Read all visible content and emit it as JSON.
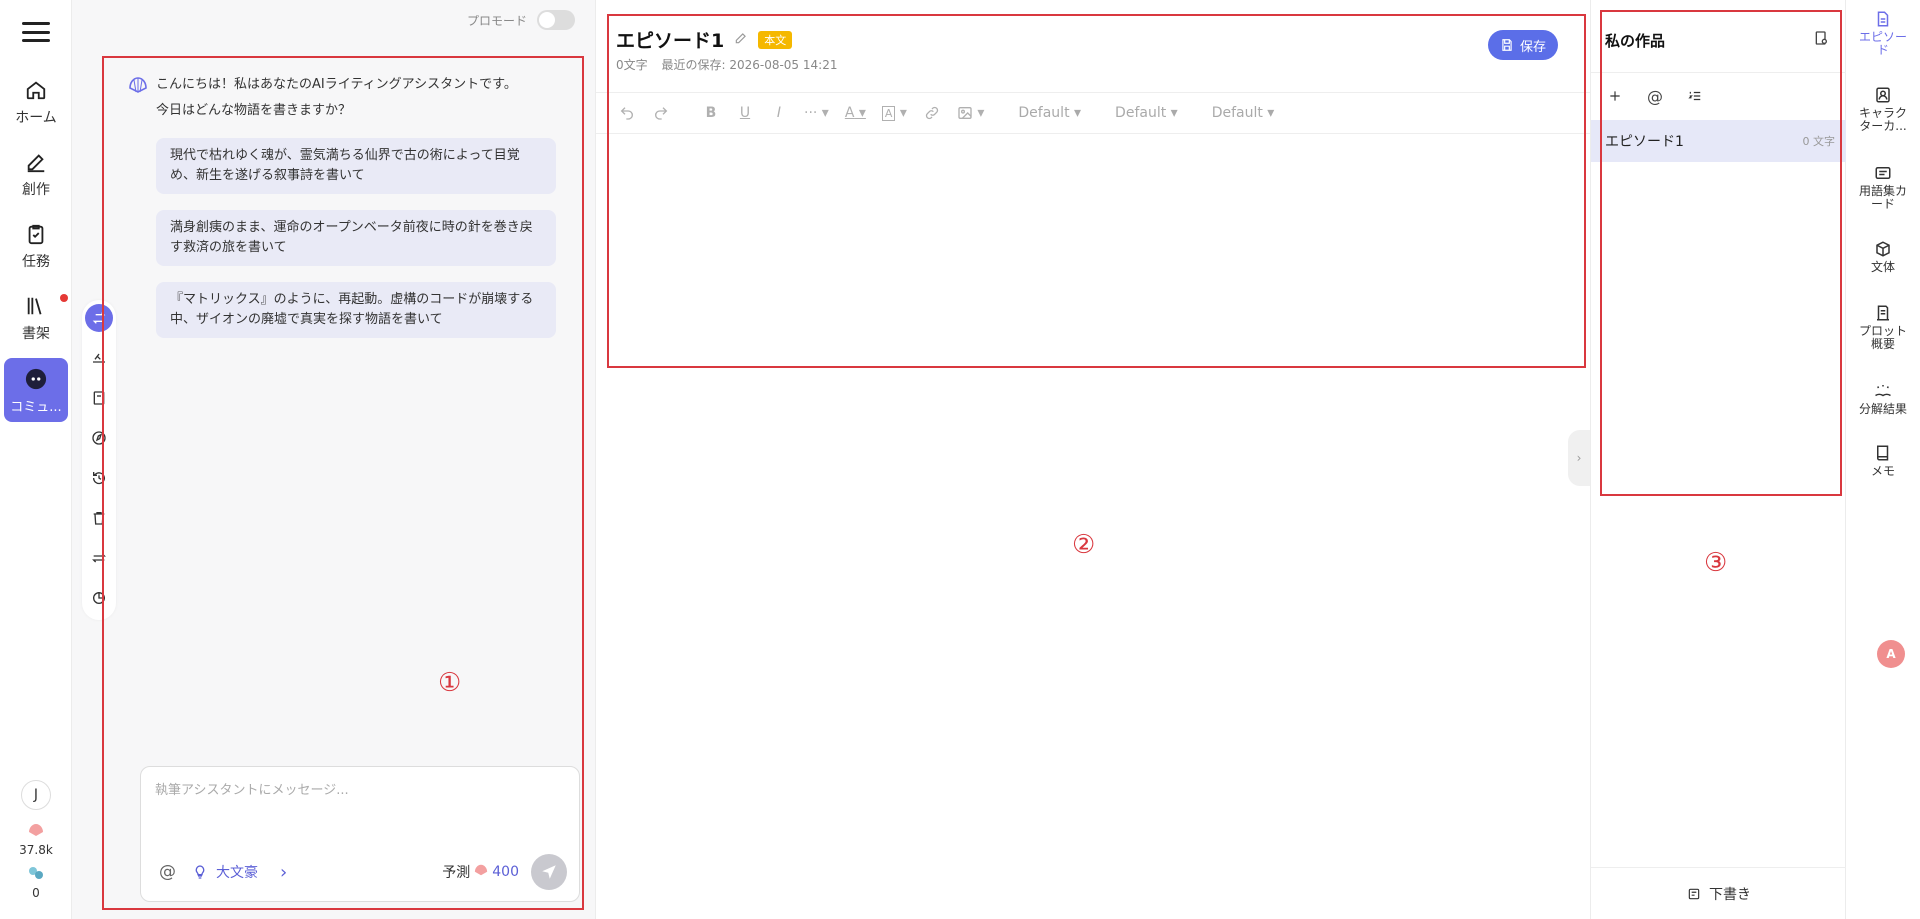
{
  "nav": {
    "items": [
      {
        "id": "home",
        "label": "ホーム"
      },
      {
        "id": "create",
        "label": "創作"
      },
      {
        "id": "task",
        "label": "任務"
      },
      {
        "id": "shelf",
        "label": "書架"
      },
      {
        "id": "community",
        "label": "コミュ..."
      }
    ],
    "user_initial": "J",
    "points": "37.8k",
    "second_count": "0"
  },
  "chat": {
    "pro_mode_label": "プロモード",
    "greeting_line1": "こんにちは！私はあなたのAIライティングアシスタントです。",
    "greeting_line2": "今日はどんな物語を書きますか？",
    "suggestions": [
      "現代で枯れゆく魂が、霊気満ちる仙界で古の術によって目覚め、新生を遂げる叙事詩を書いて",
      "満身創痍のまま、運命のオープンベータ前夜に時の針を巻き戻す救済の旅を書いて",
      "『マトリックス』のように、再起動。虚構のコードが崩壊する中、ザイオンの廃墟で真実を探す物語を書いて"
    ],
    "input_placeholder": "執筆アシスタントにメッセージ...",
    "at_symbol": "@",
    "outline_label": "大文豪",
    "predict_label": "予測",
    "predict_value": "400"
  },
  "editor": {
    "title": "エピソード1",
    "badge": "本文",
    "word_count": "0文字",
    "last_saved": "最近の保存: 2026-08-05 14:21",
    "save_label": "保存",
    "toolbar": {
      "more": "···",
      "font_color": "A",
      "highlight": "A",
      "select1": "Default",
      "select2": "Default",
      "select3": "Default"
    }
  },
  "works": {
    "title": "私の作品",
    "episodes": [
      {
        "name": "エピソード1",
        "count": "0 文字"
      }
    ],
    "draft_label": "下書き"
  },
  "rail": {
    "items": [
      {
        "id": "episode",
        "label": "エピソード"
      },
      {
        "id": "character",
        "label": "キャラクターカ..."
      },
      {
        "id": "glossary",
        "label": "用語集カード"
      },
      {
        "id": "style",
        "label": "文体"
      },
      {
        "id": "plot",
        "label": "プロット概要"
      },
      {
        "id": "analysis",
        "label": "分解結果"
      },
      {
        "id": "memo",
        "label": "メモ"
      }
    ]
  },
  "annotations": [
    "①",
    "②",
    "③"
  ],
  "colors": {
    "accent": "#6c6ee8",
    "annotation": "#d9383f",
    "badge": "#f5b800"
  }
}
